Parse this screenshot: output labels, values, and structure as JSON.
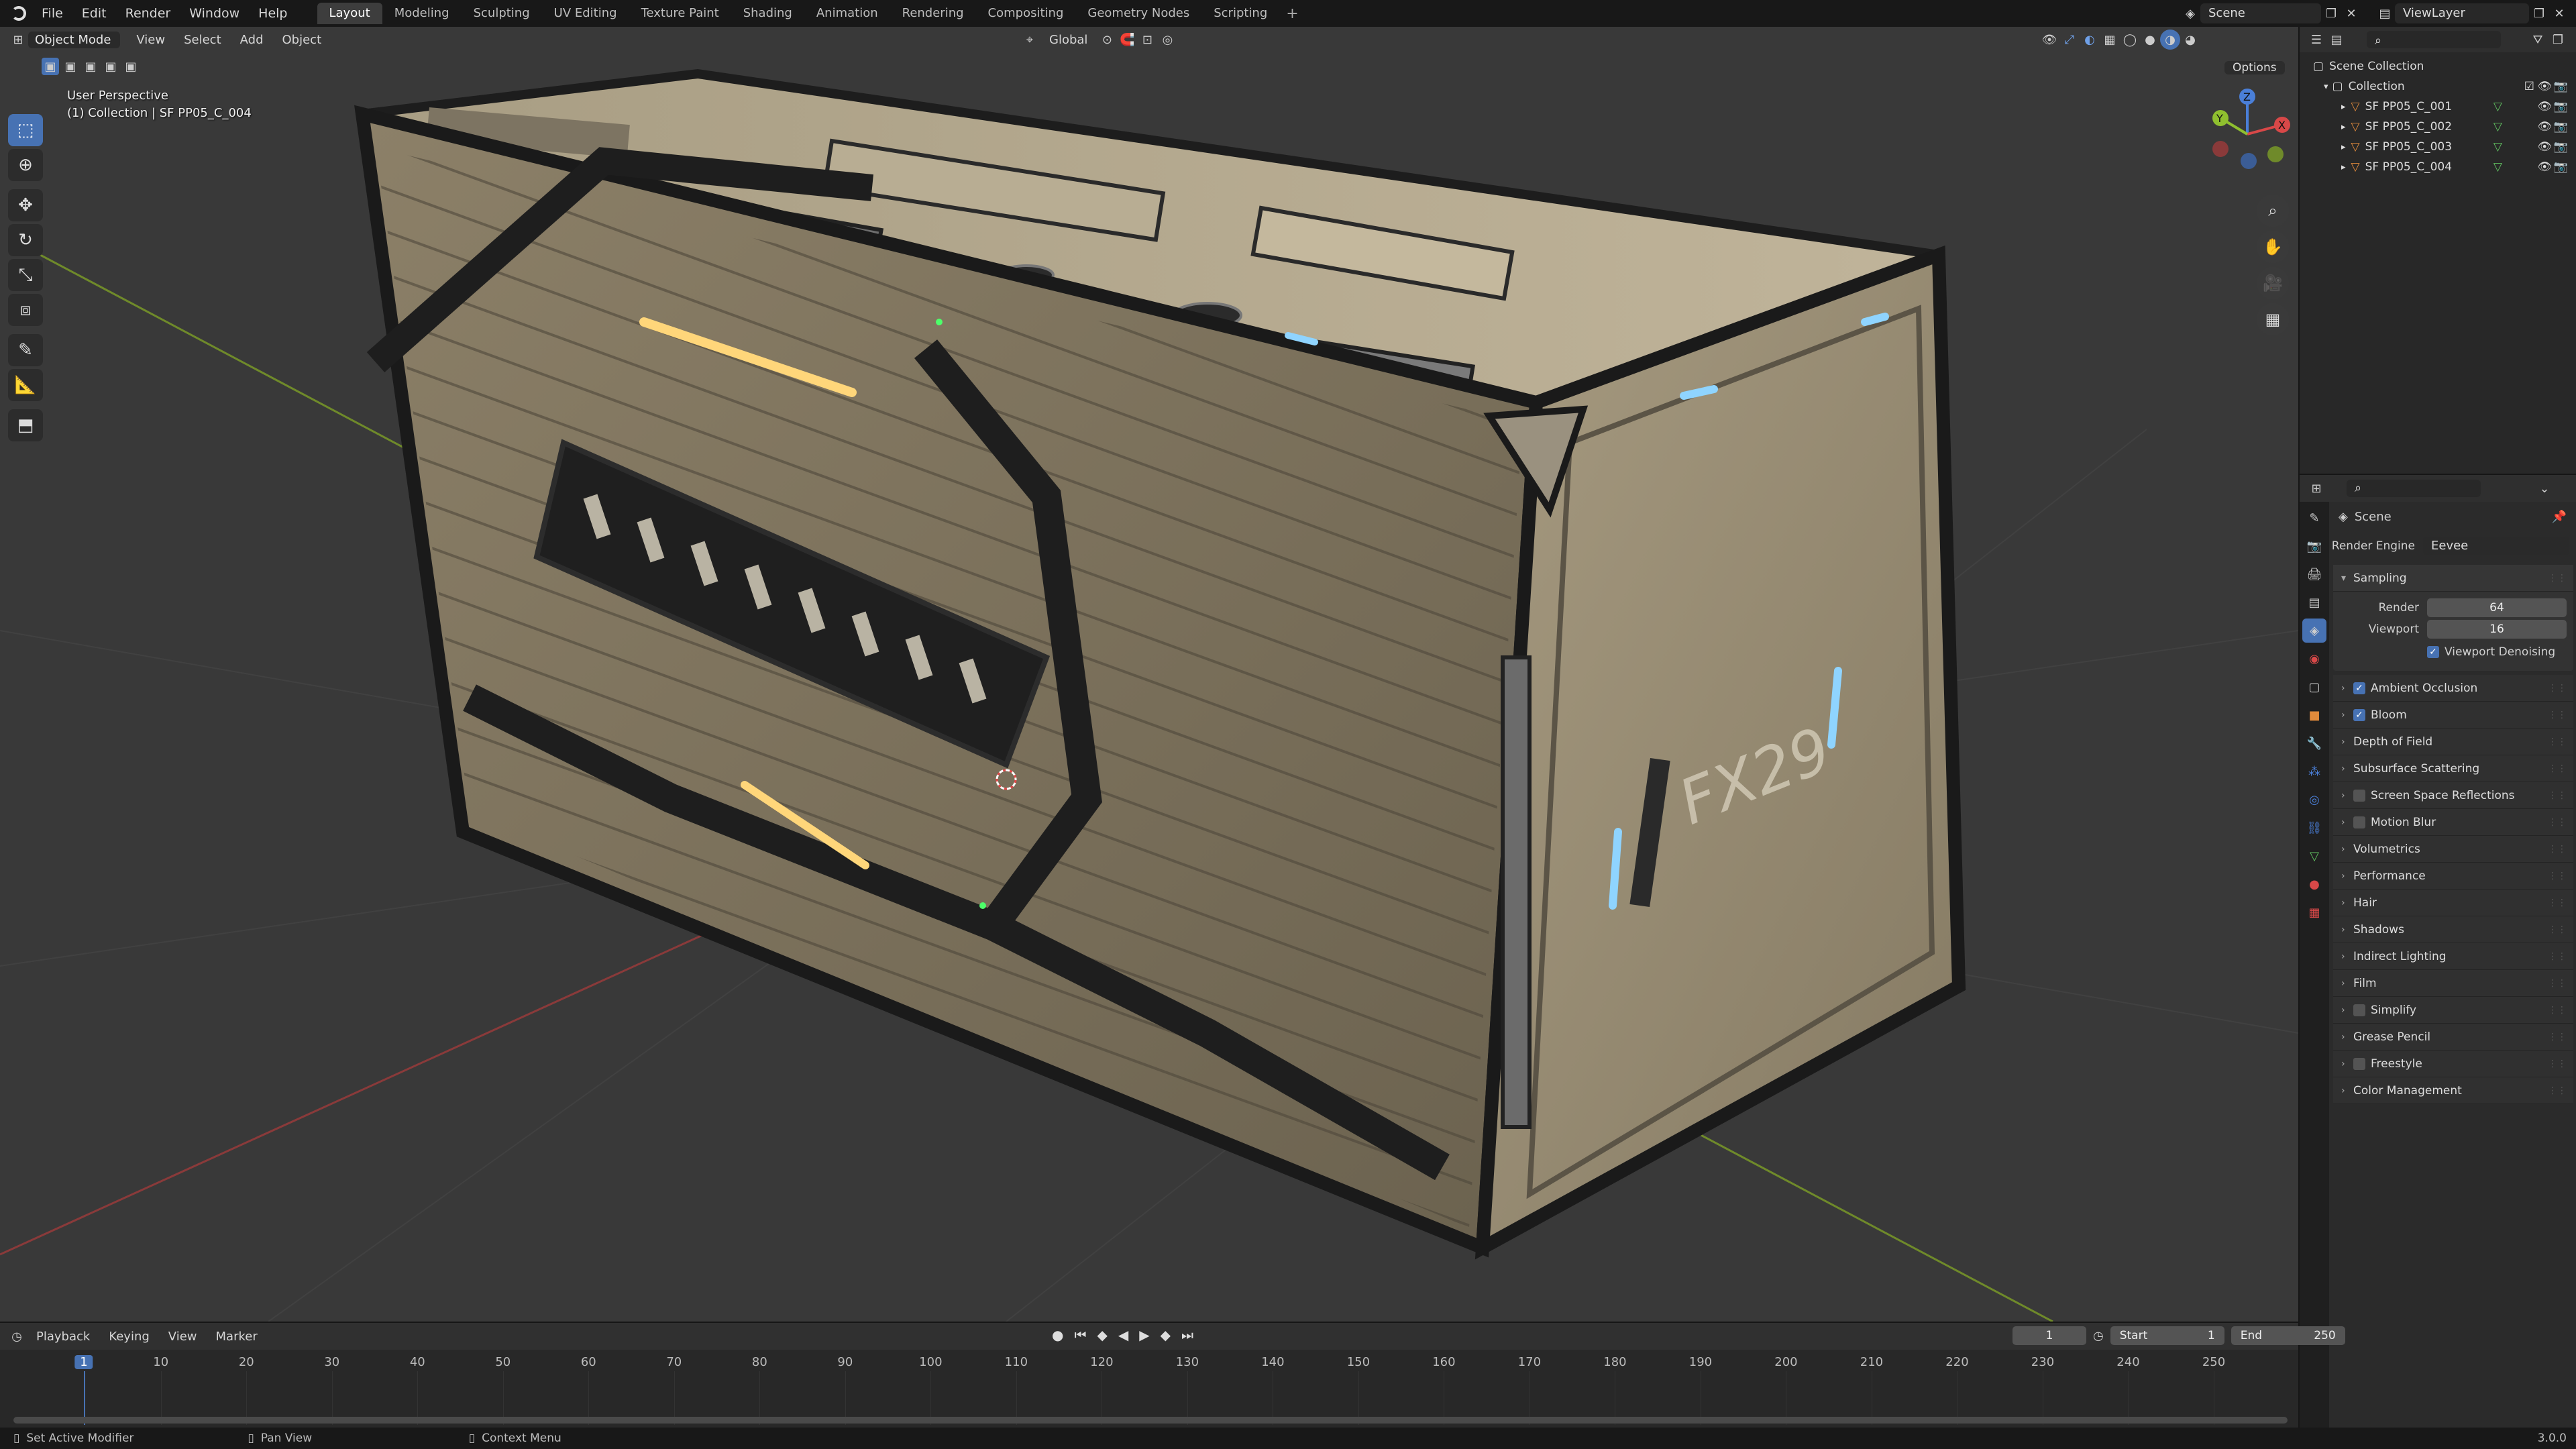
{
  "topbar": {
    "menus": [
      "File",
      "Edit",
      "Render",
      "Window",
      "Help"
    ],
    "workspaces": [
      "Layout",
      "Modeling",
      "Sculpting",
      "UV Editing",
      "Texture Paint",
      "Shading",
      "Animation",
      "Rendering",
      "Compositing",
      "Geometry Nodes",
      "Scripting"
    ],
    "active_workspace": "Layout",
    "add_tab": "+",
    "scene": "Scene",
    "view_layer": "ViewLayer"
  },
  "viewport": {
    "mode": "Object Mode",
    "menus": [
      "View",
      "Select",
      "Add",
      "Object"
    ],
    "orientation": "Global",
    "options": "Options",
    "perspective_label": "User Perspective",
    "collection_label": "(1) Collection | SF PP05_C_004",
    "gizmo": {
      "x": "X",
      "y": "Y",
      "z": "Z"
    }
  },
  "model": {
    "decal_main": "FX29"
  },
  "outliner": {
    "root": "Scene Collection",
    "collection": "Collection",
    "objects": [
      "SF PP05_C_001",
      "SF PP05_C_002",
      "SF PP05_C_003",
      "SF PP05_C_004"
    ]
  },
  "properties": {
    "context": "Scene",
    "render_engine_label": "Render Engine",
    "render_engine": "Eevee",
    "sampling": {
      "title": "Sampling",
      "render_label": "Render",
      "render_value": "64",
      "viewport_label": "Viewport",
      "viewport_value": "16",
      "denoise_label": "Viewport Denoising"
    },
    "panels": [
      {
        "label": "Ambient Occlusion",
        "checkbox": true,
        "checked": true
      },
      {
        "label": "Bloom",
        "checkbox": true,
        "checked": true
      },
      {
        "label": "Depth of Field",
        "checkbox": false,
        "checked": false
      },
      {
        "label": "Subsurface Scattering",
        "checkbox": false,
        "checked": false
      },
      {
        "label": "Screen Space Reflections",
        "checkbox": true,
        "checked": false
      },
      {
        "label": "Motion Blur",
        "checkbox": true,
        "checked": false
      },
      {
        "label": "Volumetrics",
        "checkbox": false,
        "checked": false
      },
      {
        "label": "Performance",
        "checkbox": false,
        "checked": false
      },
      {
        "label": "Hair",
        "checkbox": false,
        "checked": false
      },
      {
        "label": "Shadows",
        "checkbox": false,
        "checked": false
      },
      {
        "label": "Indirect Lighting",
        "checkbox": false,
        "checked": false
      },
      {
        "label": "Film",
        "checkbox": false,
        "checked": false
      },
      {
        "label": "Simplify",
        "checkbox": true,
        "checked": false
      },
      {
        "label": "Grease Pencil",
        "checkbox": false,
        "checked": false
      },
      {
        "label": "Freestyle",
        "checkbox": true,
        "checked": false
      },
      {
        "label": "Color Management",
        "checkbox": false,
        "checked": false
      }
    ]
  },
  "timeline": {
    "menus": [
      "Playback",
      "Keying",
      "View",
      "Marker"
    ],
    "current_frame": "1",
    "start_label": "Start",
    "start": "1",
    "end_label": "End",
    "end": "250",
    "ticks": [
      "1",
      "10",
      "20",
      "30",
      "40",
      "50",
      "60",
      "70",
      "80",
      "90",
      "100",
      "110",
      "120",
      "130",
      "140",
      "150",
      "160",
      "170",
      "180",
      "190",
      "200",
      "210",
      "220",
      "230",
      "240",
      "250"
    ]
  },
  "statusbar": {
    "hint1": "Set Active Modifier",
    "hint2": "Pan View",
    "hint3": "Context Menu",
    "version": "3.0.0"
  },
  "colors": {
    "accent": "#4772b3",
    "viewport_bg": "#393939",
    "panel_bg": "#2b2b2b",
    "x_axis": "#d84848",
    "y_axis": "#8fbf2f",
    "z_axis": "#4a7fd8"
  }
}
